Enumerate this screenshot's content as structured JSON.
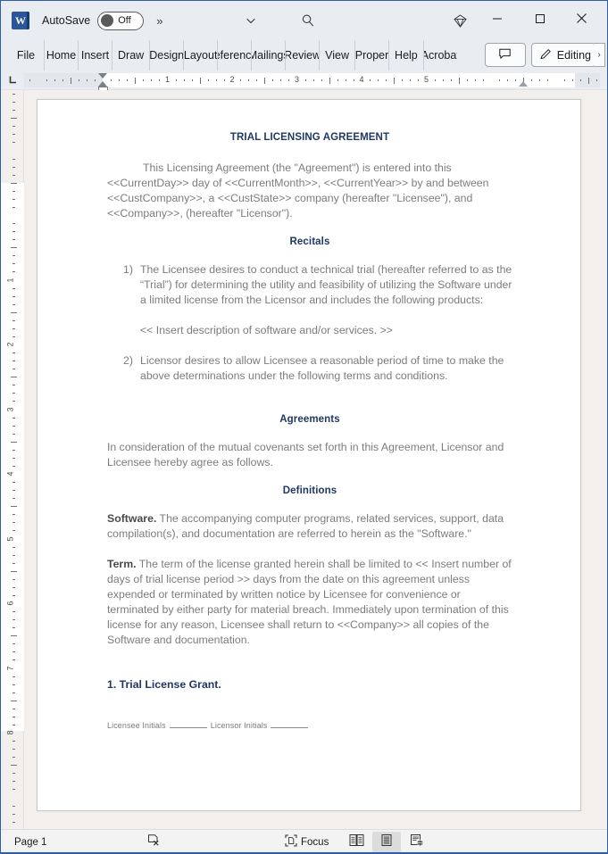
{
  "titlebar": {
    "app_logo": "word-logo",
    "autosave_label": "AutoSave",
    "autosave_state": "Off",
    "more_chevron": "»",
    "dropdown_icon": "chevron-down-icon",
    "search_icon": "search-icon",
    "diamond_icon": "diamond-icon",
    "minimize_icon": "minimize-icon",
    "maximize_icon": "maximize-icon",
    "close_icon": "close-icon"
  },
  "ribbon": {
    "tabs": [
      {
        "label": "File"
      },
      {
        "label": "Home"
      },
      {
        "label": "Insert"
      },
      {
        "label": "Draw"
      },
      {
        "label": "Design"
      },
      {
        "label": "Layout"
      },
      {
        "label": "References"
      },
      {
        "label": "Mailings"
      },
      {
        "label": "Review"
      },
      {
        "label": "View"
      },
      {
        "label": "Proper"
      },
      {
        "label": "Help"
      },
      {
        "label": "Acrobat"
      }
    ],
    "comment_button": "comment-icon",
    "editing_button": "Editing",
    "editing_icon": "pencil-icon",
    "expand_chevron": "›"
  },
  "ruler": {
    "tabstop_glyph": "L",
    "h_numbers": [
      "1",
      "2",
      "3",
      "4",
      "5"
    ],
    "v_numbers": [
      "1",
      "2",
      "3",
      "4",
      "5",
      "6",
      "7",
      "8"
    ]
  },
  "document": {
    "title": "TRIAL LICENSING AGREEMENT",
    "intro": "This Licensing Agreement (the \"Agreement\") is entered into this <<CurrentDay>> day of <<CurrentMonth>>, <<CurrentYear>> by and between <<CustCompany>>, a <<CustState>> company (hereafter \"Licensee\"), and <<Company>>, (hereafter \"Licensor\").",
    "recitals_heading": "Recitals",
    "recitals": [
      {
        "num": "1)",
        "text": "The Licensee desires to conduct a technical trial (hereafter referred to as the “Trial”) for determining the utility and feasibility of utilizing the Software under a limited license from the Licensor and includes the following products:"
      },
      {
        "num": "2)",
        "text": "Licensor desires to allow Licensee a reasonable period of time to make the above determinations under the following terms and conditions."
      }
    ],
    "insert_description": "<< Insert description of software and/or services. >>",
    "agreements_heading": "Agreements",
    "agreements_body": "In consideration of the mutual covenants set forth in this Agreement, Licensor and Licensee hereby agree as follows.",
    "definitions_heading": "Definitions",
    "software_term": "Software.",
    "software_body": " The accompanying computer programs, related services, support, data compilation(s), and documentation are referred to herein as the \"Software.\"",
    "term_term": "Term.",
    "term_body": " The term of the license granted herein shall be limited to << Insert number of days of trial license period >> days from the date on this agreement unless expended or terminated by written notice by Licensee for convenience or terminated by either party for material breach. Immediately upon termination of this license for any reason, Licensee shall return to <<Company>> all copies of the Software and documentation.",
    "grant_heading": "1. Trial License Grant.",
    "footer_licensee": "Licensee Initials",
    "footer_licensor": "Licensor Initials"
  },
  "statusbar": {
    "page_label": "Page 1",
    "proofing_icon": "proofing-errors-icon",
    "focus_label": "Focus",
    "focus_icon": "focus-icon",
    "view_read": "read-mode-icon",
    "view_print": "print-layout-icon",
    "view_web": "web-layout-icon"
  },
  "colors": {
    "accent": "#2b579a",
    "heading": "#1f3864",
    "body_text": "#7c7c7c",
    "chrome": "#e9edf2",
    "canvas": "#f2efed"
  }
}
